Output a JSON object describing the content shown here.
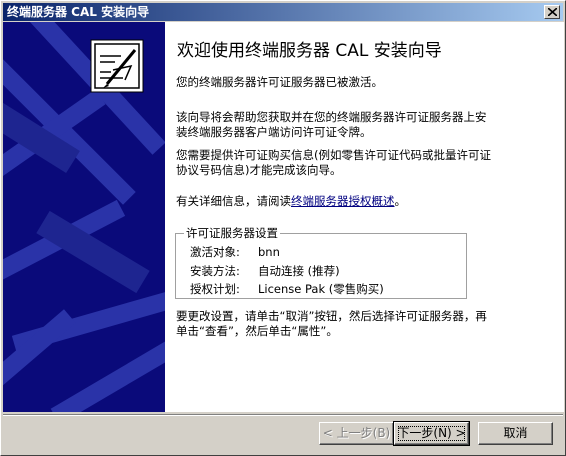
{
  "window": {
    "title": "终端服务器 CAL 安装向导",
    "close_glyph": "✕"
  },
  "content": {
    "heading": "欢迎使用终端服务器 CAL 安装向导",
    "para1": "您的终端服务器许可证服务器已被激活。",
    "para2": "该向导将会帮助您获取并在您的终端服务器许可证服务器上安装终端服务器客户端访问许可证令牌。",
    "para3": "您需要提供许可证购买信息(例如零售许可证代码或批量许可证协议号码信息)才能完成该向导。",
    "para4_prefix": "有关详细信息，请阅读",
    "para4_link": "终端服务器授权概述",
    "para4_suffix": "。",
    "settings": {
      "title": "许可证服务器设置",
      "rows": [
        {
          "label": "激活对象:",
          "value": "bnn"
        },
        {
          "label": "安装方法:",
          "value": "自动连接 (推荐)"
        },
        {
          "label": "授权计划:",
          "value": "License Pak (零售购买)"
        }
      ]
    },
    "para5": "要更改设置，请单击“取消”按钮，然后选择许可证服务器，再单击“查看”，然后单击“属性”。"
  },
  "buttons": {
    "back": "< 上一步(B)",
    "next": "下一步(N) >",
    "cancel": "取消"
  },
  "colors": {
    "banner_bg": "#0a0a7a",
    "titlebar_start": "#0a246a",
    "titlebar_end": "#a6caf0",
    "link": "#000080"
  },
  "icons": {
    "wizard": "certificate-pen-icon",
    "close": "close-icon"
  }
}
